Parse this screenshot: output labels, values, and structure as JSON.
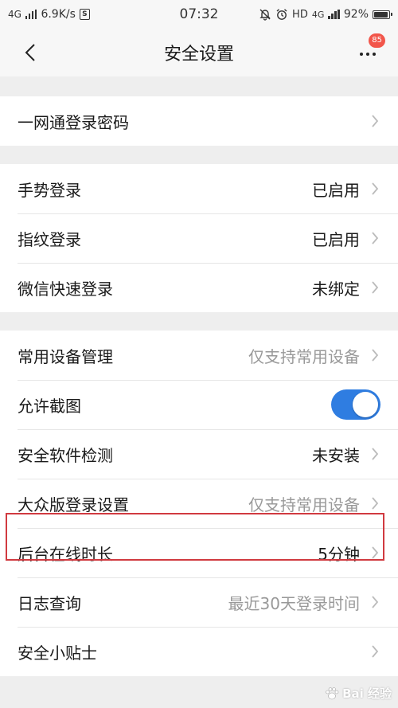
{
  "status_bar": {
    "network": "4G",
    "speed": "6.9K/s",
    "s_icon": "S",
    "time": "07:32",
    "hd": "HD",
    "net_right": "4G",
    "battery": "92%"
  },
  "nav": {
    "title": "安全设置",
    "badge_count": "85"
  },
  "sections": [
    [
      {
        "label": "一网通登录密码",
        "value": ""
      }
    ],
    [
      {
        "label": "手势登录",
        "value": "已启用"
      },
      {
        "label": "指纹登录",
        "value": "已启用"
      },
      {
        "label": "微信快速登录",
        "value": "未绑定"
      }
    ],
    [
      {
        "label": "常用设备管理",
        "value": "仅支持常用设备"
      },
      {
        "label": "允许截图",
        "toggle_on": true
      },
      {
        "label": "安全软件检测",
        "value": "未安装"
      },
      {
        "label": "大众版登录设置",
        "value": "仅支持常用设备"
      },
      {
        "label": "后台在线时长",
        "value": "5分钟"
      },
      {
        "label": "日志查询",
        "value": "最近30天登录时间"
      },
      {
        "label": "安全小贴士",
        "value": ""
      }
    ]
  ],
  "watermark": {
    "text": "Bai 经验"
  },
  "colors": {
    "toggle_on": "#2f7de1",
    "badge": "#f2564b",
    "highlight": "#d13a40",
    "muted_text": "#999999"
  }
}
